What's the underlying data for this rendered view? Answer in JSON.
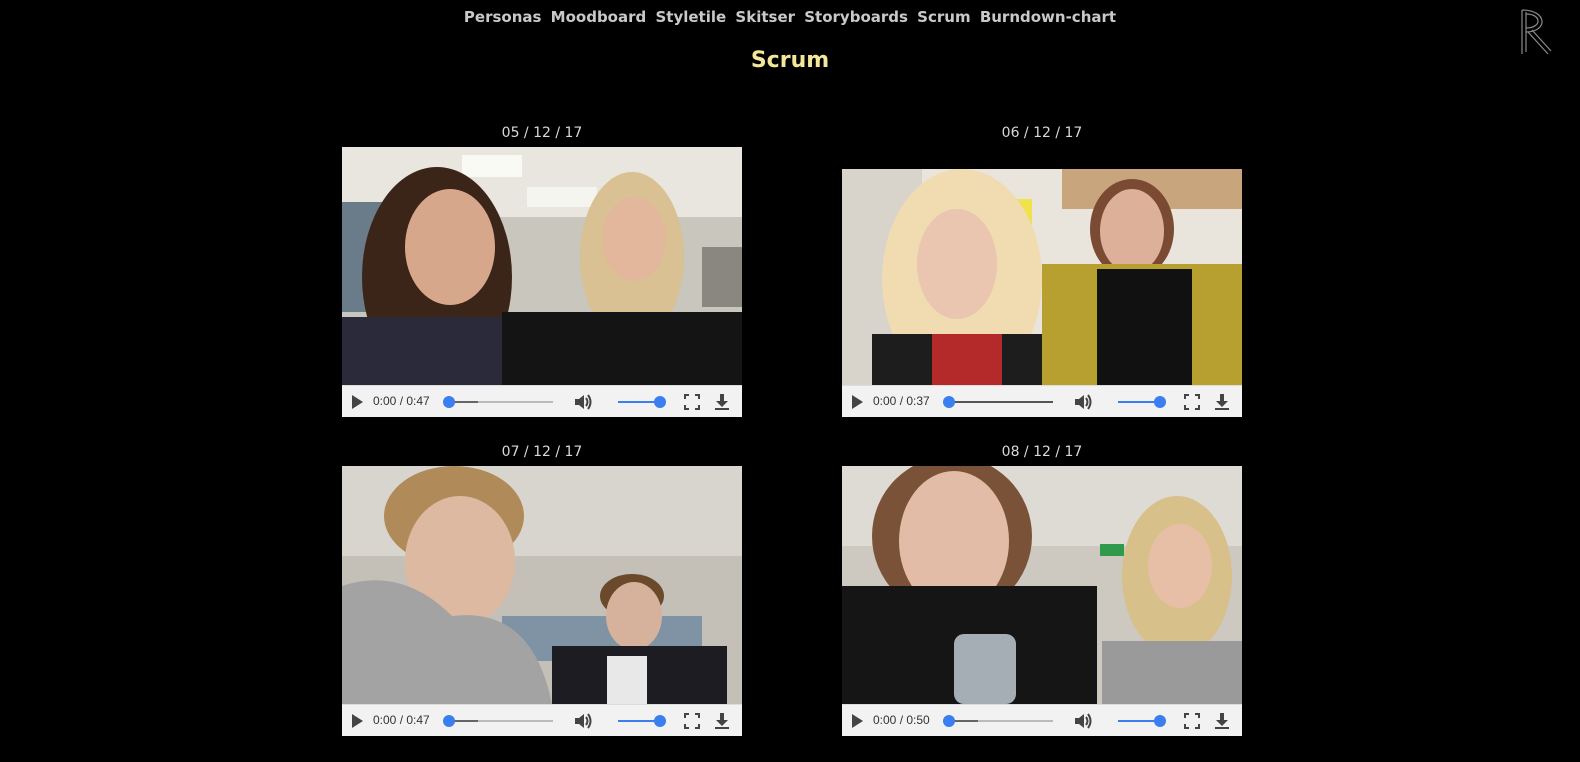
{
  "nav": {
    "items": [
      {
        "label": "Personas"
      },
      {
        "label": "Moodboard"
      },
      {
        "label": "Styletile"
      },
      {
        "label": "Skitser"
      },
      {
        "label": "Storyboards"
      },
      {
        "label": "Scrum"
      },
      {
        "label": "Burndown-chart"
      }
    ]
  },
  "page": {
    "title": "Scrum"
  },
  "colors": {
    "title": "#f4e79a",
    "nav": "#c9c9c9",
    "accent": "#3b7ef0",
    "background": "#000000"
  },
  "videos": [
    {
      "date": "05 / 12 / 17",
      "time": "0:00 / 0:47",
      "buffered": 0.28,
      "volume": 1.0
    },
    {
      "date": "06 / 12 / 17",
      "time": "0:00 / 0:37",
      "buffered": 0.0,
      "volume": 1.0
    },
    {
      "date": "07 / 12 / 17",
      "time": "0:00 / 0:47",
      "buffered": 0.28,
      "volume": 1.0
    },
    {
      "date": "08 / 12 / 17",
      "time": "0:00 / 0:50",
      "buffered": 0.28,
      "volume": 1.0
    }
  ],
  "icons": {
    "play": "play-icon",
    "volume": "volume-icon",
    "fullscreen": "fullscreen-icon",
    "download": "download-icon",
    "logo": "r-logo-icon"
  }
}
